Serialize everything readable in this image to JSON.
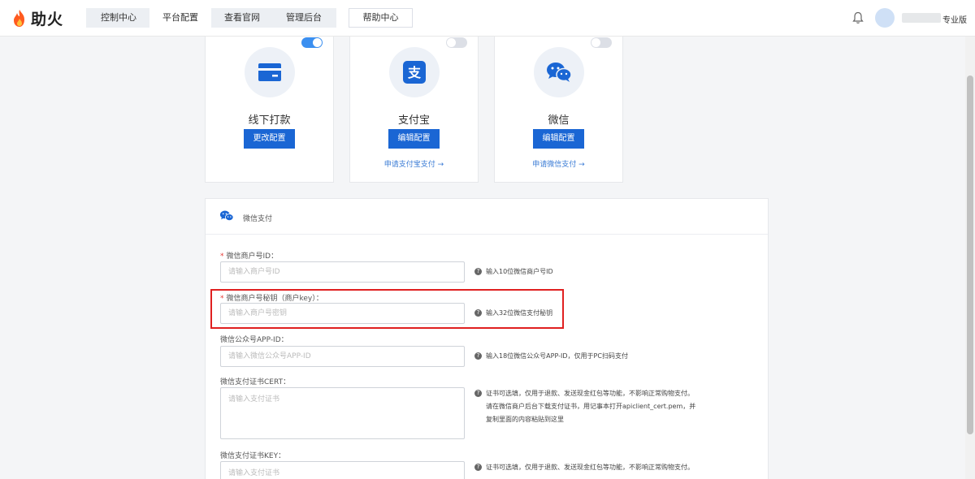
{
  "brand": {
    "name": "助火",
    "color": "#ff5a1f"
  },
  "nav": {
    "tabs": [
      {
        "label": "控制中心"
      },
      {
        "label": "平台配置"
      },
      {
        "label": "查看官网"
      },
      {
        "label": "管理后台"
      }
    ],
    "active_tab": "平台配置",
    "help_label": "帮助中心"
  },
  "user": {
    "edition": "专业版"
  },
  "payment_methods": [
    {
      "title": "线下打款",
      "enabled": true,
      "button": "更改配置",
      "link": "",
      "icon": "card-icon"
    },
    {
      "title": "支付宝",
      "enabled": false,
      "button": "编辑配置",
      "link": "申请支付宝支付 →",
      "icon": "alipay-icon"
    },
    {
      "title": "微信",
      "enabled": false,
      "button": "编辑配置",
      "link": "申请微信支付 →",
      "icon": "wechat-icon"
    }
  ],
  "wechat_form": {
    "title": "微信支付",
    "merchant_id": {
      "label": "微信商户号ID：",
      "required": true,
      "placeholder": "请输入商户号ID",
      "hint": "输入10位微信商户号ID"
    },
    "merchant_key": {
      "label": "微信商户号秘钥（商户key）：",
      "required": true,
      "placeholder": "请输入商户号密钥",
      "hint": "输入32位微信支付秘钥"
    },
    "app_id": {
      "label": "微信公众号APP-ID：",
      "required": false,
      "placeholder": "请输入微信公众号APP-ID",
      "hint": "输入18位微信公众号APP-ID，仅用于PC扫码支付"
    },
    "cert": {
      "label": "微信支付证书CERT：",
      "placeholder": "请输入支付证书",
      "hint_lines": [
        "证书可选填，仅用于退款、发送现金红包等功能，不影响正常购物支付。",
        "请在微信商户后台下载支付证书，用记事本打开apiclient_cert.pem，并",
        "复制里面的内容粘贴到这里"
      ]
    },
    "key": {
      "label": "微信支付证书KEY：",
      "placeholder": "请输入支付证书",
      "hint_lines": [
        "证书可选填，仅用于退款、发送现金红包等功能，不影响正常购物支付。"
      ]
    }
  },
  "colors": {
    "primary_button": "#1a66d4",
    "toggle_on": "#3b8ff0",
    "highlight": "#e02020",
    "required": "#e53935"
  }
}
